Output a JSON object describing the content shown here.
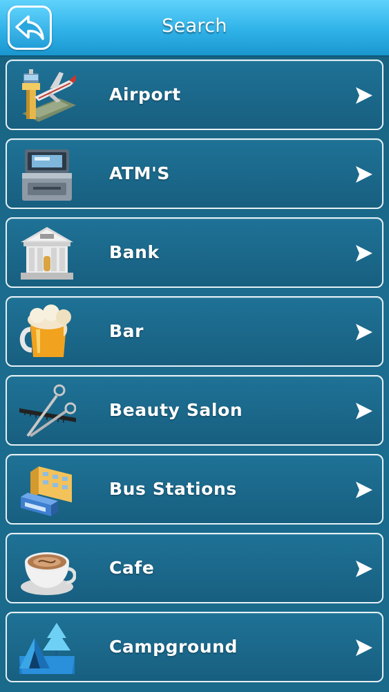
{
  "header": {
    "title": "Search"
  },
  "items": [
    {
      "label": "Airport",
      "icon": "airport-icon"
    },
    {
      "label": "ATM'S",
      "icon": "atm-icon"
    },
    {
      "label": "Bank",
      "icon": "bank-icon"
    },
    {
      "label": "Bar",
      "icon": "beer-mug-icon"
    },
    {
      "label": "Beauty Salon",
      "icon": "scissors-comb-icon"
    },
    {
      "label": "Bus Stations",
      "icon": "bus-station-icon"
    },
    {
      "label": "Cafe",
      "icon": "coffee-cup-icon"
    },
    {
      "label": "Campground",
      "icon": "campground-tent-icon"
    }
  ],
  "colors": {
    "header_top": "#5fd2fb",
    "header_bottom": "#1b96cf",
    "background": "#1b6d8f",
    "row_border": "#e6f1f6",
    "text": "#ffffff"
  }
}
